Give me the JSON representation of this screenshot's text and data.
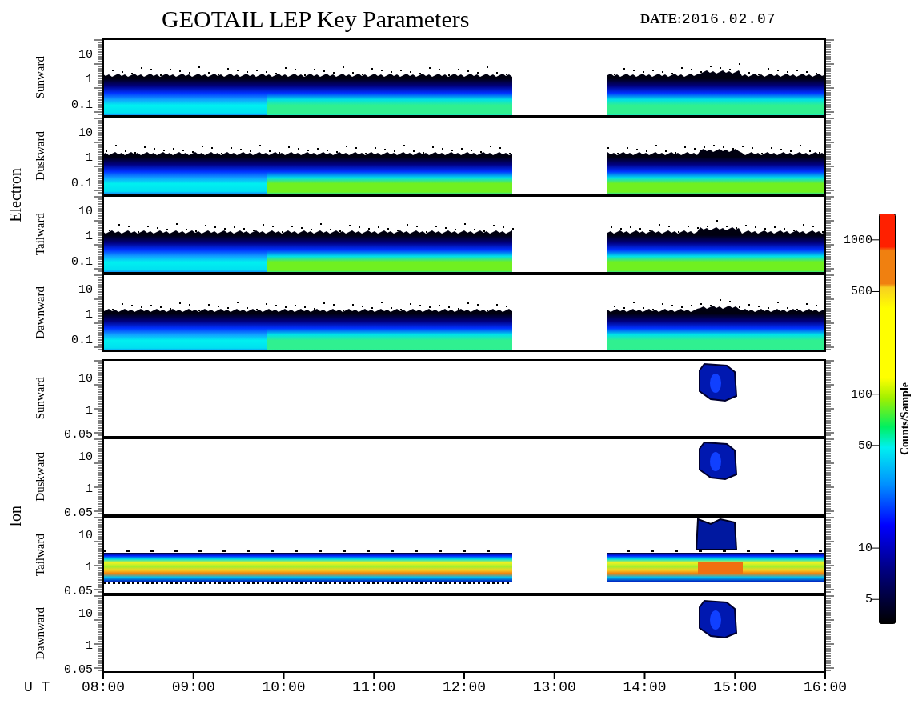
{
  "title": "GEOTAIL LEP Key Parameters",
  "date": {
    "label": "DATE:",
    "value": "2016.02.07"
  },
  "groups": [
    {
      "name": "Electron",
      "kind": "electron",
      "panels": [
        {
          "direction": "Sunward",
          "kind": "electron-band",
          "yticks": [
            "10",
            "1",
            "0.1"
          ]
        },
        {
          "direction": "Duskward",
          "kind": "electron-band",
          "yticks": [
            "10",
            "1",
            "0.1"
          ]
        },
        {
          "direction": "Tailward",
          "kind": "electron-band",
          "yticks": [
            "10",
            "1",
            "0.1"
          ]
        },
        {
          "direction": "Dawnward",
          "kind": "electron-band",
          "yticks": [
            "10",
            "1",
            "0.1"
          ]
        }
      ]
    },
    {
      "name": "Ion",
      "kind": "ion",
      "panels": [
        {
          "direction": "Sunward",
          "kind": "ion-burst",
          "yticks": [
            "10",
            "1",
            "0.05"
          ]
        },
        {
          "direction": "Duskward",
          "kind": "ion-burst",
          "yticks": [
            "10",
            "1",
            "0.05"
          ]
        },
        {
          "direction": "Tailward",
          "kind": "ion-band",
          "yticks": [
            "10",
            "1",
            "0.05"
          ]
        },
        {
          "direction": "Dawnward",
          "kind": "ion-burst",
          "yticks": [
            "10",
            "1",
            "0.05"
          ]
        }
      ]
    }
  ],
  "x_axis": {
    "label": "U T",
    "ticks": [
      "08:00",
      "09:00",
      "10:00",
      "11:00",
      "12:00",
      "13:00",
      "14:00",
      "15:00",
      "16:00"
    ]
  },
  "colorbar": {
    "title": "Counts/Sample",
    "ticks": [
      "1000",
      "500",
      "100",
      "50",
      "10",
      "5"
    ]
  }
}
